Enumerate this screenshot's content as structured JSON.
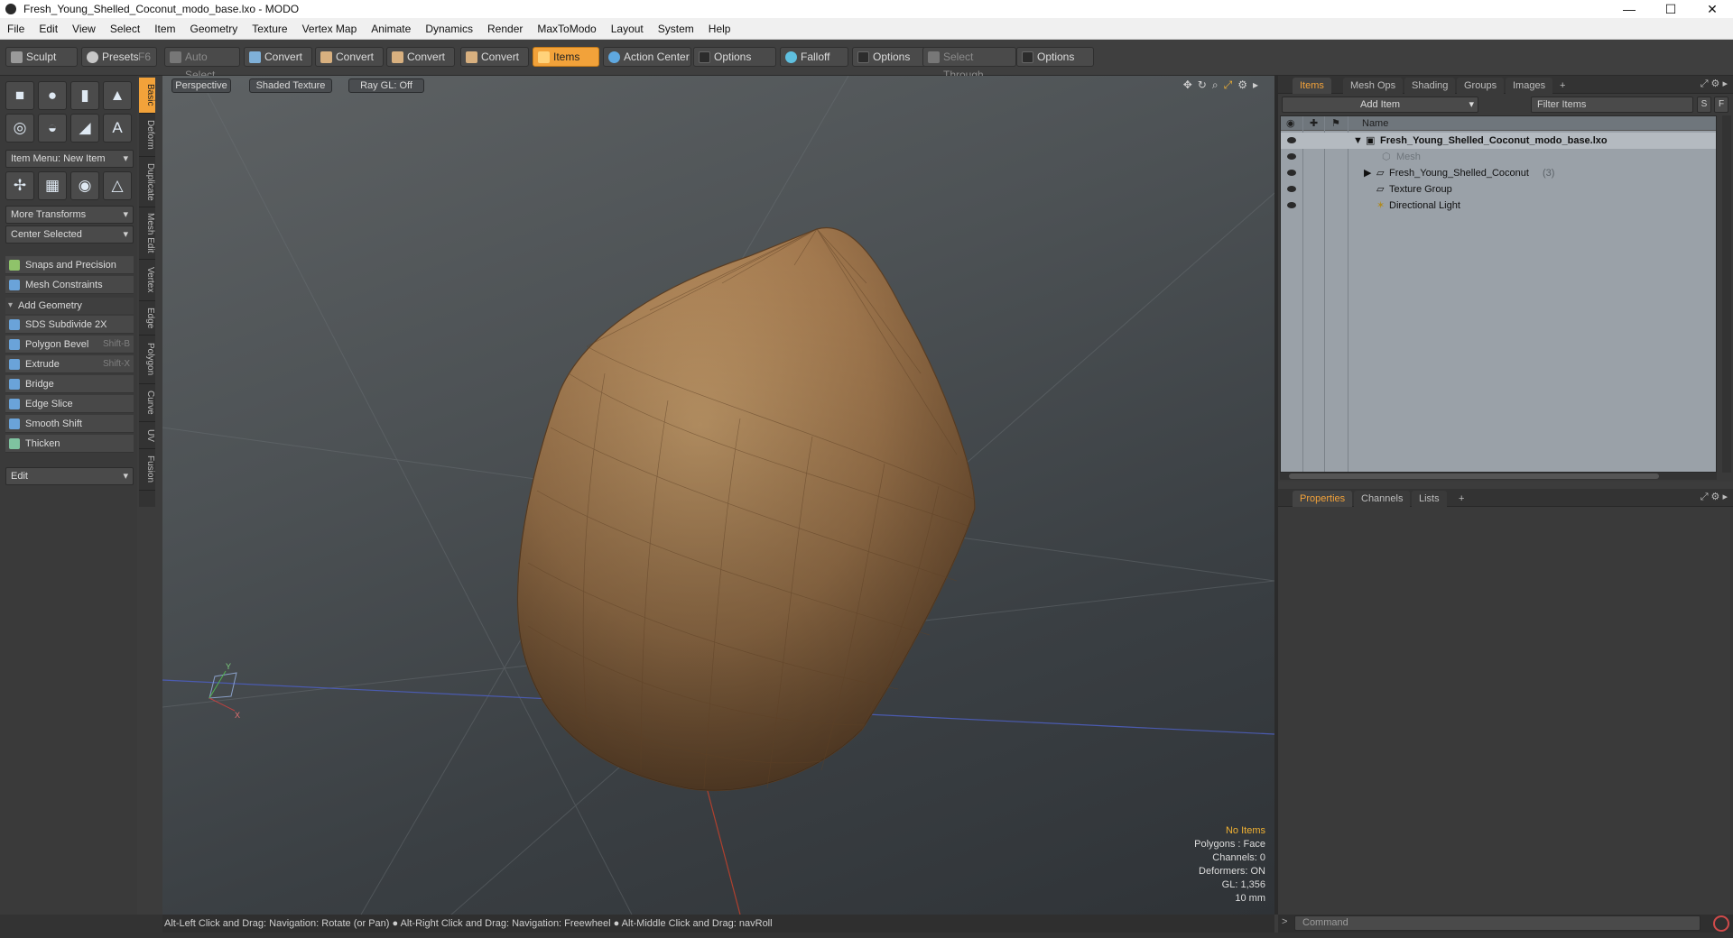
{
  "window": {
    "title": "Fresh_Young_Shelled_Coconut_modo_base.lxo - MODO",
    "controls": [
      "—",
      "☐",
      "✕"
    ]
  },
  "menubar": [
    "File",
    "Edit",
    "View",
    "Select",
    "Item",
    "Geometry",
    "Texture",
    "Vertex Map",
    "Animate",
    "Dynamics",
    "Render",
    "MaxToModo",
    "Layout",
    "System",
    "Help"
  ],
  "toolbar": {
    "sculpt": "Sculpt",
    "presets": "Presets",
    "presets_key": "F6",
    "auto_select": "Auto Select",
    "convert1": "Convert",
    "convert2": "Convert",
    "convert3": "Convert",
    "convert4": "Convert",
    "items": "Items",
    "action_center": "Action Center",
    "options1": "Options",
    "falloff": "Falloff",
    "options2": "Options",
    "select_through": "Select Through",
    "options3": "Options"
  },
  "leftpanel": {
    "item_menu": "Item Menu: New Item",
    "more_transforms": "More Transforms",
    "center_selected": "Center Selected",
    "snaps": "Snaps and Precision",
    "mesh_constraints": "Mesh Constraints",
    "add_geometry": "Add Geometry",
    "tools": [
      {
        "label": "SDS Subdivide 2X",
        "key": ""
      },
      {
        "label": "Polygon Bevel",
        "key": "Shift-B"
      },
      {
        "label": "Extrude",
        "key": "Shift-X"
      },
      {
        "label": "Bridge",
        "key": ""
      },
      {
        "label": "Edge Slice",
        "key": ""
      },
      {
        "label": "Smooth Shift",
        "key": ""
      },
      {
        "label": "Thicken",
        "key": ""
      }
    ],
    "edit": "Edit"
  },
  "vtabs": [
    "Basic",
    "Deform",
    "Duplicate",
    "Mesh Edit",
    "Vertex",
    "Edge",
    "Polygon",
    "Curve",
    "UV",
    "Fusion"
  ],
  "viewport": {
    "perspective": "Perspective",
    "shading": "Shaded Texture",
    "raygl": "Ray GL: Off",
    "hud": {
      "no_items": "No Items",
      "polygons": "Polygons : Face",
      "channels": "Channels: 0",
      "deformers": "Deformers: ON",
      "gl": "GL: 1,356",
      "scale": "10 mm"
    },
    "mesh_color": "#b58a5c"
  },
  "statusbar": "Alt-Left Click and Drag: Navigation: Rotate (or Pan) ● Alt-Right Click and Drag: Navigation: Freewheel ● Alt-Middle Click and Drag: navRoll",
  "items_panel": {
    "tabs": [
      "Items",
      "Mesh Ops",
      "Shading",
      "Groups",
      "Images"
    ],
    "add_item": "Add Item",
    "filter": "Filter Items",
    "btn_s": "S",
    "btn_f": "F",
    "col_name": "Name",
    "tree": {
      "root": "Fresh_Young_Shelled_Coconut_modo_base.lxo",
      "mesh": "Mesh",
      "coconut": "Fresh_Young_Shelled_Coconut",
      "coconut_count": "(3)",
      "texture_group": "Texture Group",
      "light": "Directional Light"
    }
  },
  "props_panel": {
    "tabs": [
      "Properties",
      "Channels",
      "Lists"
    ]
  },
  "command": {
    "placeholder": "Command"
  },
  "accent": "#f2a23a"
}
